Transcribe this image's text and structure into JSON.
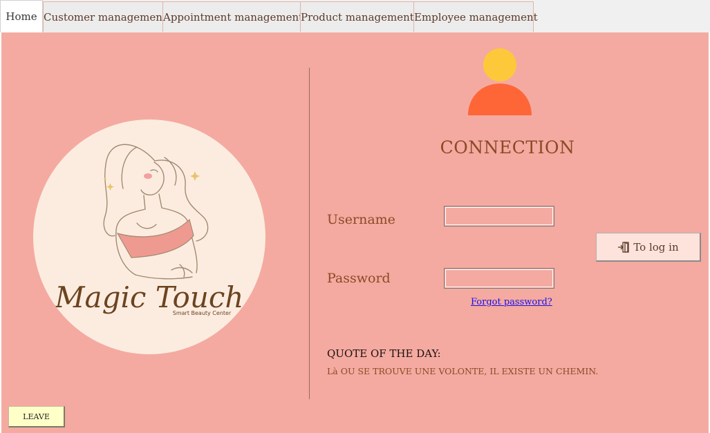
{
  "tabs": [
    {
      "label": "Home",
      "active": true
    },
    {
      "label": "Customer management",
      "active": false
    },
    {
      "label": "Appointment management",
      "active": false
    },
    {
      "label": "Product management",
      "active": false
    },
    {
      "label": "Employee management",
      "active": false
    }
  ],
  "logo": {
    "brand": "Magic Touch",
    "tagline": "Smart Beauty Center"
  },
  "login": {
    "title": "CONNECTION",
    "username_label": "Username",
    "username_value": "",
    "password_label": "Password",
    "password_value": "",
    "login_button": "To log in",
    "forgot_link": "Forgot password?"
  },
  "quote": {
    "heading": "QUOTE OF THE DAY:",
    "text": "Là OU SE TROUVE UNE VOLONTE, IL EXISTE UN CHEMIN."
  },
  "leave_button": "LEAVE",
  "colors": {
    "background": "#f4aaa0",
    "avatar_head": "#fdc93a",
    "avatar_body": "#fe6638",
    "accent_text": "#8a4a26",
    "leave_button": "#ffffc8"
  },
  "icons": {
    "avatar": "user-avatar-icon",
    "login": "door-enter-icon"
  }
}
